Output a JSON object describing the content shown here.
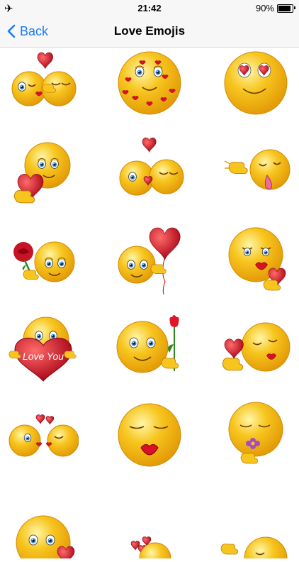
{
  "status": {
    "time": "21:42",
    "battery": "90%",
    "battery_level": 0.9
  },
  "nav": {
    "back_label": "Back",
    "title": "Love Emojis"
  },
  "colors": {
    "accent": "#1b7cf5",
    "face": "#f7c51e",
    "face_edge": "#e39a06",
    "heart": "#e3192b"
  },
  "emojis": [
    {
      "name": "emoji-kissing-couple",
      "kind": "kiss-couple"
    },
    {
      "name": "emoji-lipstick-kisses",
      "kind": "lipstick"
    },
    {
      "name": "emoji-heart-eyes",
      "kind": "heart-eyes"
    },
    {
      "name": "emoji-offering-heart",
      "kind": "give-heart"
    },
    {
      "name": "emoji-couple-heart-above",
      "kind": "couple-heart"
    },
    {
      "name": "emoji-blowing-kiss-tongue",
      "kind": "tongue-kiss"
    },
    {
      "name": "emoji-with-rose",
      "kind": "rose"
    },
    {
      "name": "emoji-heart-balloon",
      "kind": "balloon"
    },
    {
      "name": "emoji-kiss-heart-hand",
      "kind": "kiss-heart"
    },
    {
      "name": "emoji-love-you-heart",
      "kind": "love-you",
      "text": "Love You"
    },
    {
      "name": "emoji-with-tulip",
      "kind": "tulip"
    },
    {
      "name": "emoji-kiss-heart-flying",
      "kind": "kiss-fly"
    },
    {
      "name": "emoji-couple-small-hearts",
      "kind": "couple-small"
    },
    {
      "name": "emoji-pucker-kiss",
      "kind": "pucker"
    },
    {
      "name": "emoji-with-flower",
      "kind": "flower"
    },
    {
      "name": "emoji-worried-heart",
      "kind": "partial1"
    },
    {
      "name": "emoji-hearts-bouquet",
      "kind": "partial2"
    },
    {
      "name": "emoji-tongue-partial",
      "kind": "partial3"
    }
  ]
}
